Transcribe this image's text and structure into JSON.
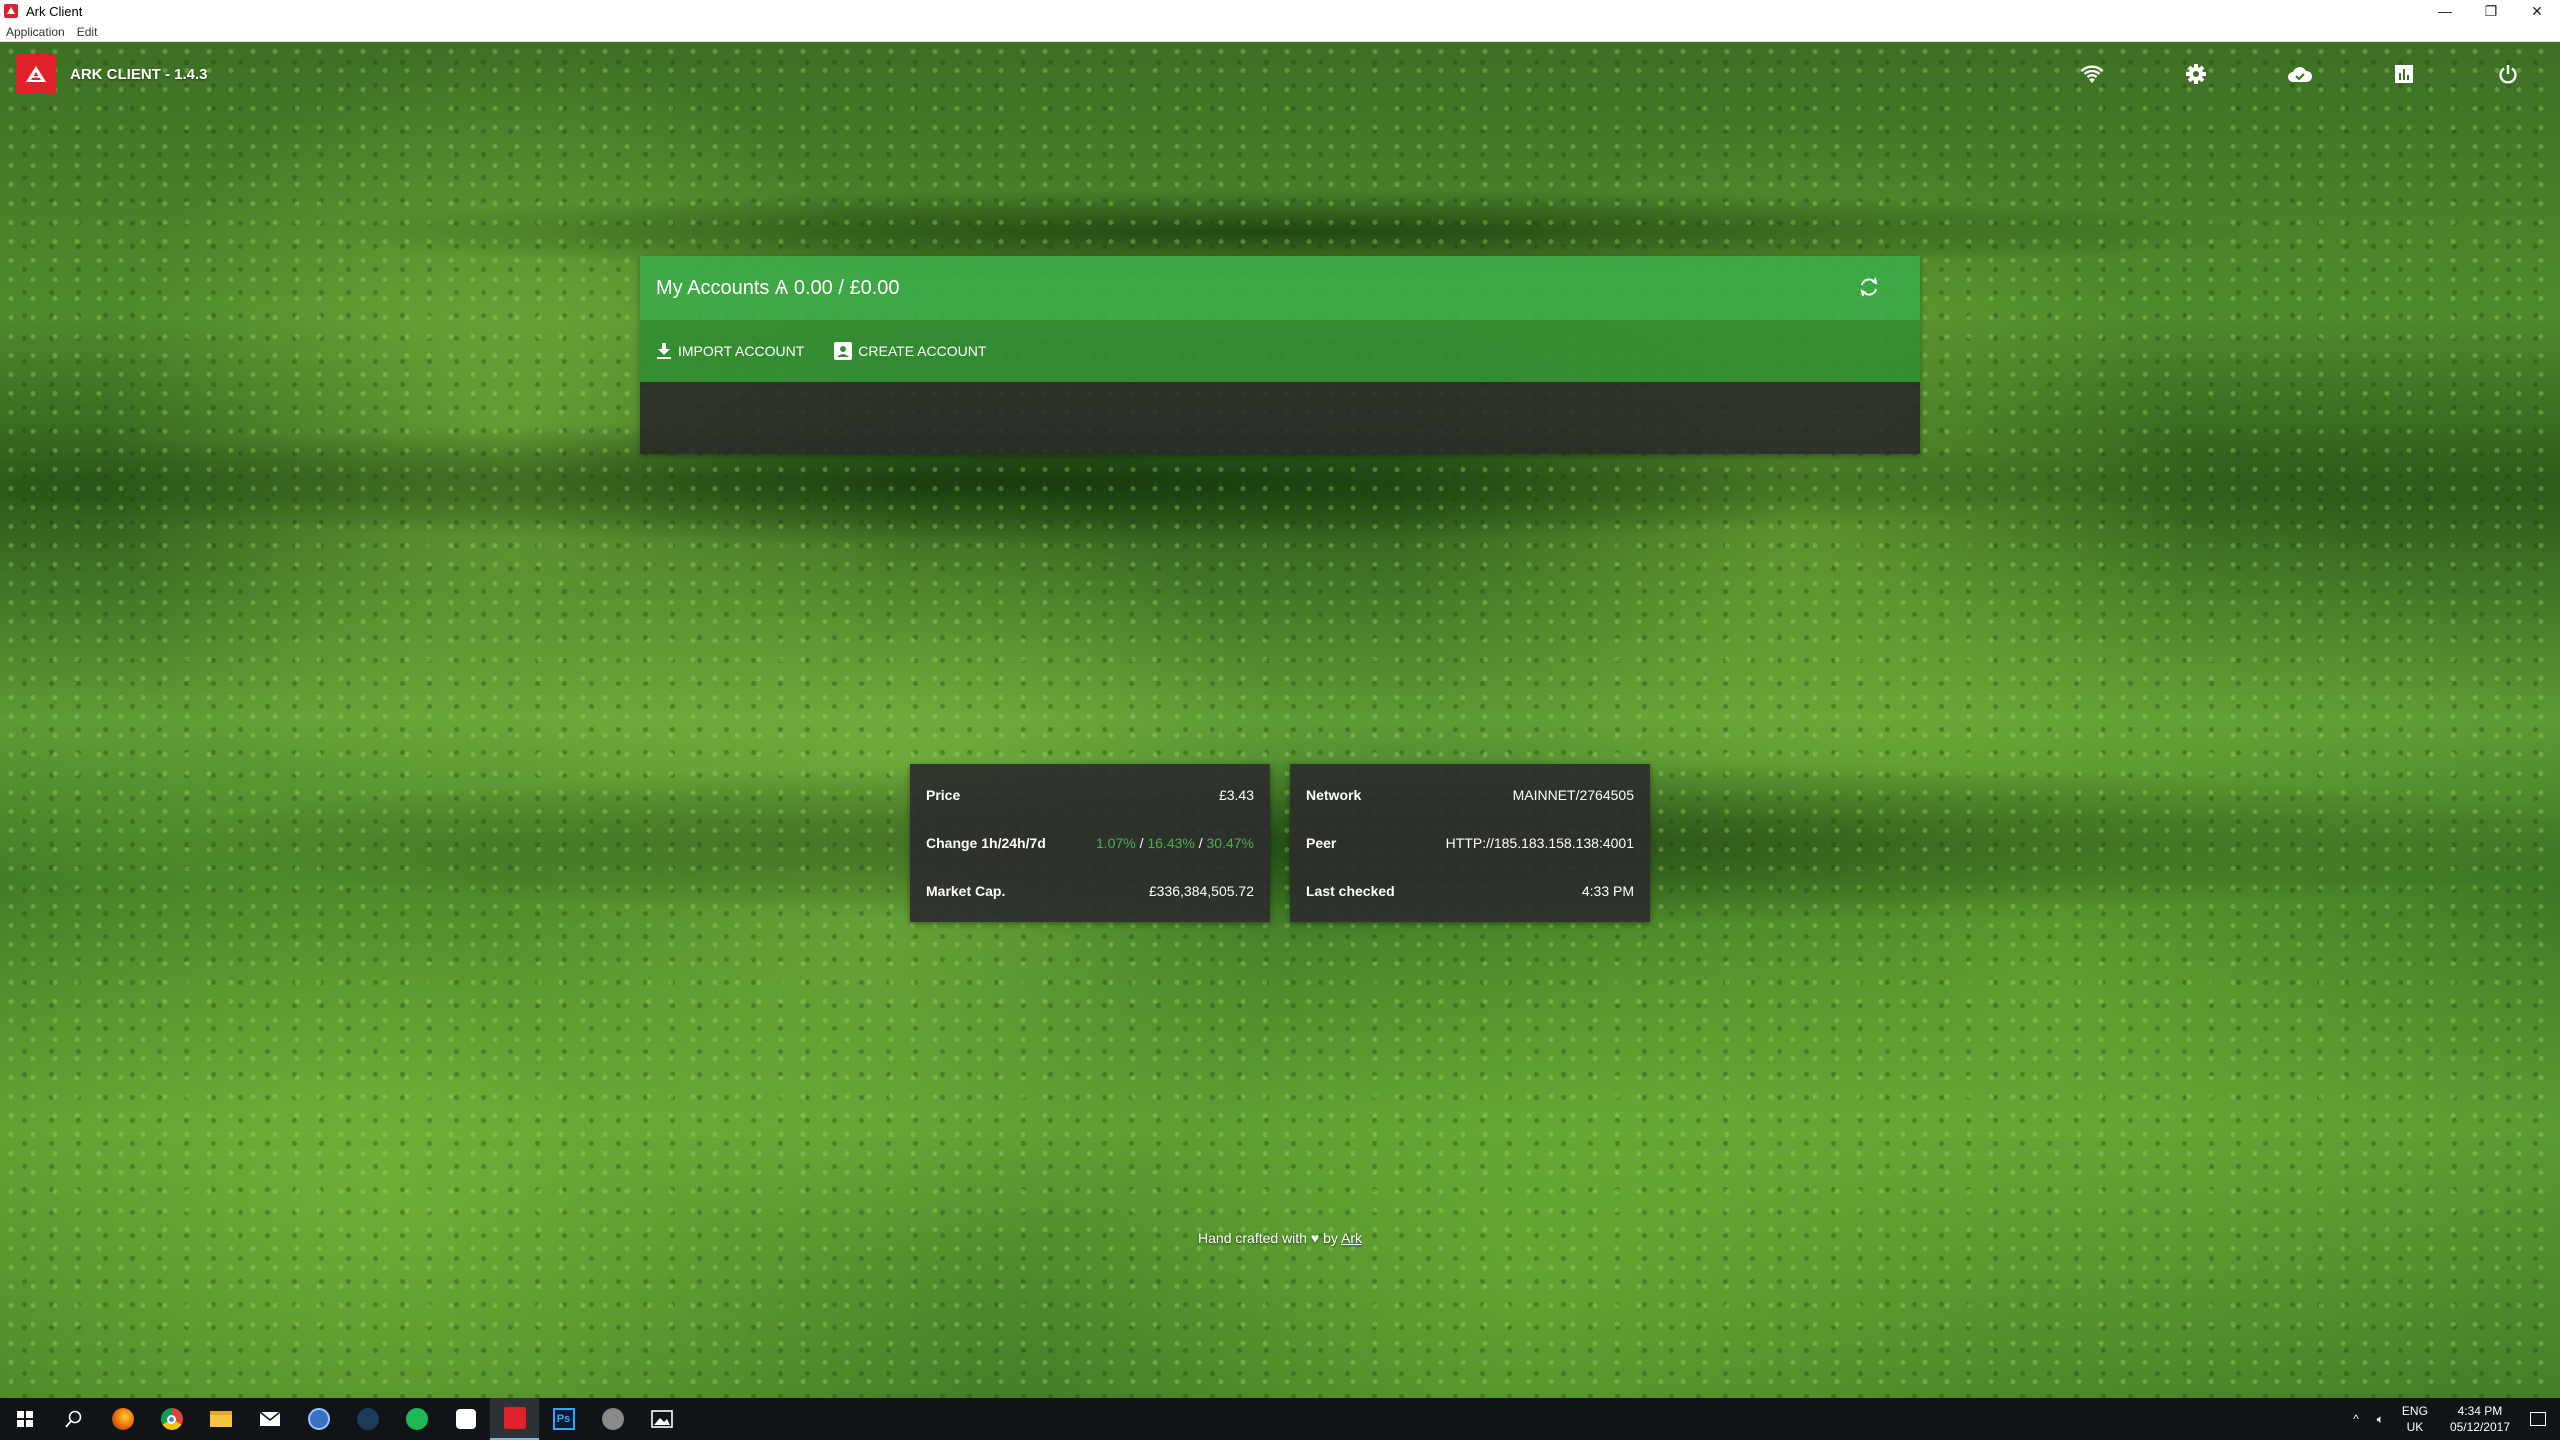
{
  "window": {
    "title": "Ark Client",
    "controls": [
      "—",
      "❐",
      "✕"
    ]
  },
  "menubar": [
    "Application",
    "Edit"
  ],
  "header": {
    "app_title": "ARK CLIENT - 1.4.3",
    "icons": [
      "wifi-icon",
      "settings-icon",
      "cloud-icon",
      "chart-icon",
      "power-icon"
    ]
  },
  "accounts": {
    "title": "My Accounts Ѧ 0.00 / £0.00",
    "import_label": "IMPORT ACCOUNT",
    "create_label": "CREATE ACCOUNT"
  },
  "market": {
    "price_label": "Price",
    "price_value": "£3.43",
    "change_label": "Change 1h/24h/7d",
    "change_1h": "1.07%",
    "change_24h": "16.43%",
    "change_7d": "30.47%",
    "sep": "/",
    "marketcap_label": "Market Cap.",
    "marketcap_value": "£336,384,505.72"
  },
  "network": {
    "network_label": "Network",
    "network_value": "MAINNET/2764505",
    "peer_label": "Peer",
    "peer_value": "HTTP://185.183.158.138:4001",
    "checked_label": "Last checked",
    "checked_value": "4:33 PM"
  },
  "footer": {
    "text_before": "Hand crafted with",
    "text_by": "by",
    "link": "Ark"
  },
  "taskbar": {
    "lang_line1": "ENG",
    "lang_line2": "UK",
    "time": "4:34 PM",
    "date": "05/12/2017"
  },
  "colors": {
    "accent_green": "#3caa46",
    "ark_red": "#e0202a",
    "positive": "#4caf50"
  }
}
